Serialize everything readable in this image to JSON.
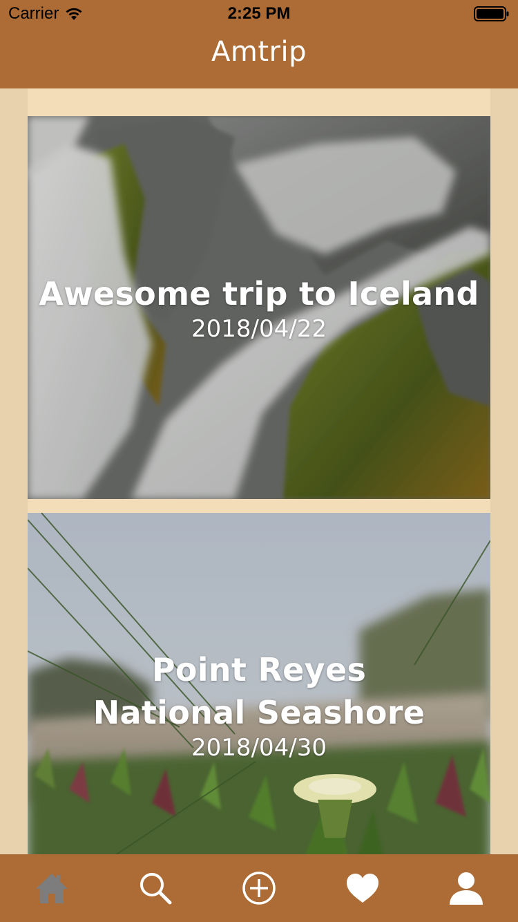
{
  "status_bar": {
    "carrier": "Carrier",
    "time": "2:25 PM"
  },
  "nav": {
    "title": "Amtrip"
  },
  "colors": {
    "brand": "#ad6c35",
    "background": "#e8d2ad",
    "feed_background": "#f2ddb8",
    "tab_active": "#7d7d7d",
    "tab_inactive": "#ffffff"
  },
  "trips": [
    {
      "title": "Awesome trip to Iceland",
      "date": "2018/04/22",
      "image": "waterfall-moss-rocks"
    },
    {
      "title": "Point Reyes\nNational Seashore",
      "date": "2018/04/30",
      "image": "beach-dune-grass-flower"
    }
  ],
  "tabs": [
    {
      "name": "home",
      "icon": "home-icon",
      "active": true
    },
    {
      "name": "search",
      "icon": "search-icon",
      "active": false
    },
    {
      "name": "add",
      "icon": "add-circle-icon",
      "active": false
    },
    {
      "name": "favorites",
      "icon": "heart-icon",
      "active": false
    },
    {
      "name": "profile",
      "icon": "user-icon",
      "active": false
    }
  ]
}
